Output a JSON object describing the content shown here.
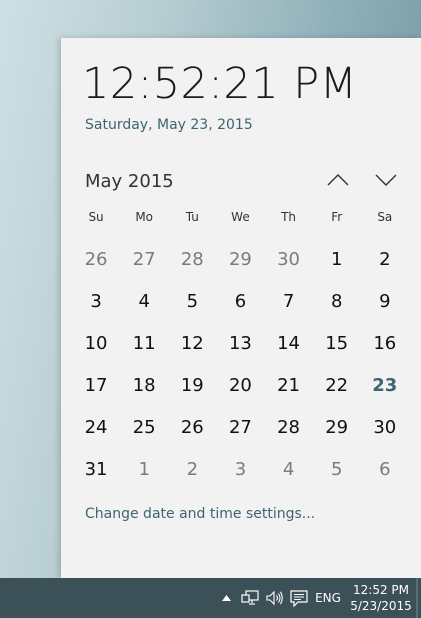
{
  "flyout": {
    "time": "12:52:21 PM",
    "date_long": "Saturday, May 23, 2015",
    "month_label": "May 2015",
    "weekdays": [
      "Su",
      "Mo",
      "Tu",
      "We",
      "Th",
      "Fr",
      "Sa"
    ],
    "weeks": [
      [
        {
          "d": "26",
          "o": true
        },
        {
          "d": "27",
          "o": true
        },
        {
          "d": "28",
          "o": true
        },
        {
          "d": "29",
          "o": true
        },
        {
          "d": "30",
          "o": true
        },
        {
          "d": "1"
        },
        {
          "d": "2"
        }
      ],
      [
        {
          "d": "3"
        },
        {
          "d": "4"
        },
        {
          "d": "5"
        },
        {
          "d": "6"
        },
        {
          "d": "7"
        },
        {
          "d": "8"
        },
        {
          "d": "9"
        }
      ],
      [
        {
          "d": "10"
        },
        {
          "d": "11"
        },
        {
          "d": "12"
        },
        {
          "d": "13"
        },
        {
          "d": "14"
        },
        {
          "d": "15"
        },
        {
          "d": "16"
        }
      ],
      [
        {
          "d": "17"
        },
        {
          "d": "18"
        },
        {
          "d": "19"
        },
        {
          "d": "20"
        },
        {
          "d": "21"
        },
        {
          "d": "22"
        },
        {
          "d": "23",
          "today": true
        }
      ],
      [
        {
          "d": "24"
        },
        {
          "d": "25"
        },
        {
          "d": "26"
        },
        {
          "d": "27"
        },
        {
          "d": "28"
        },
        {
          "d": "29"
        },
        {
          "d": "30"
        }
      ],
      [
        {
          "d": "31"
        },
        {
          "d": "1",
          "o": true
        },
        {
          "d": "2",
          "o": true
        },
        {
          "d": "3",
          "o": true
        },
        {
          "d": "4",
          "o": true
        },
        {
          "d": "5",
          "o": true
        },
        {
          "d": "6",
          "o": true
        }
      ]
    ],
    "settings_link": "Change date and time settings...",
    "prev_icon": "chevron-up-icon",
    "next_icon": "chevron-down-icon"
  },
  "taskbar": {
    "tray_icons": [
      "show-hidden-icons-chevron",
      "network-icon",
      "volume-icon",
      "action-center-icon"
    ],
    "language": "ENG",
    "clock_time": "12:52 PM",
    "clock_date": "5/23/2015"
  },
  "colors": {
    "accent": "#3f6470",
    "flyout_bg": "#f2f2f2",
    "taskbar_bg": "#3b5057",
    "other_month_day": "#7b7b7b"
  }
}
